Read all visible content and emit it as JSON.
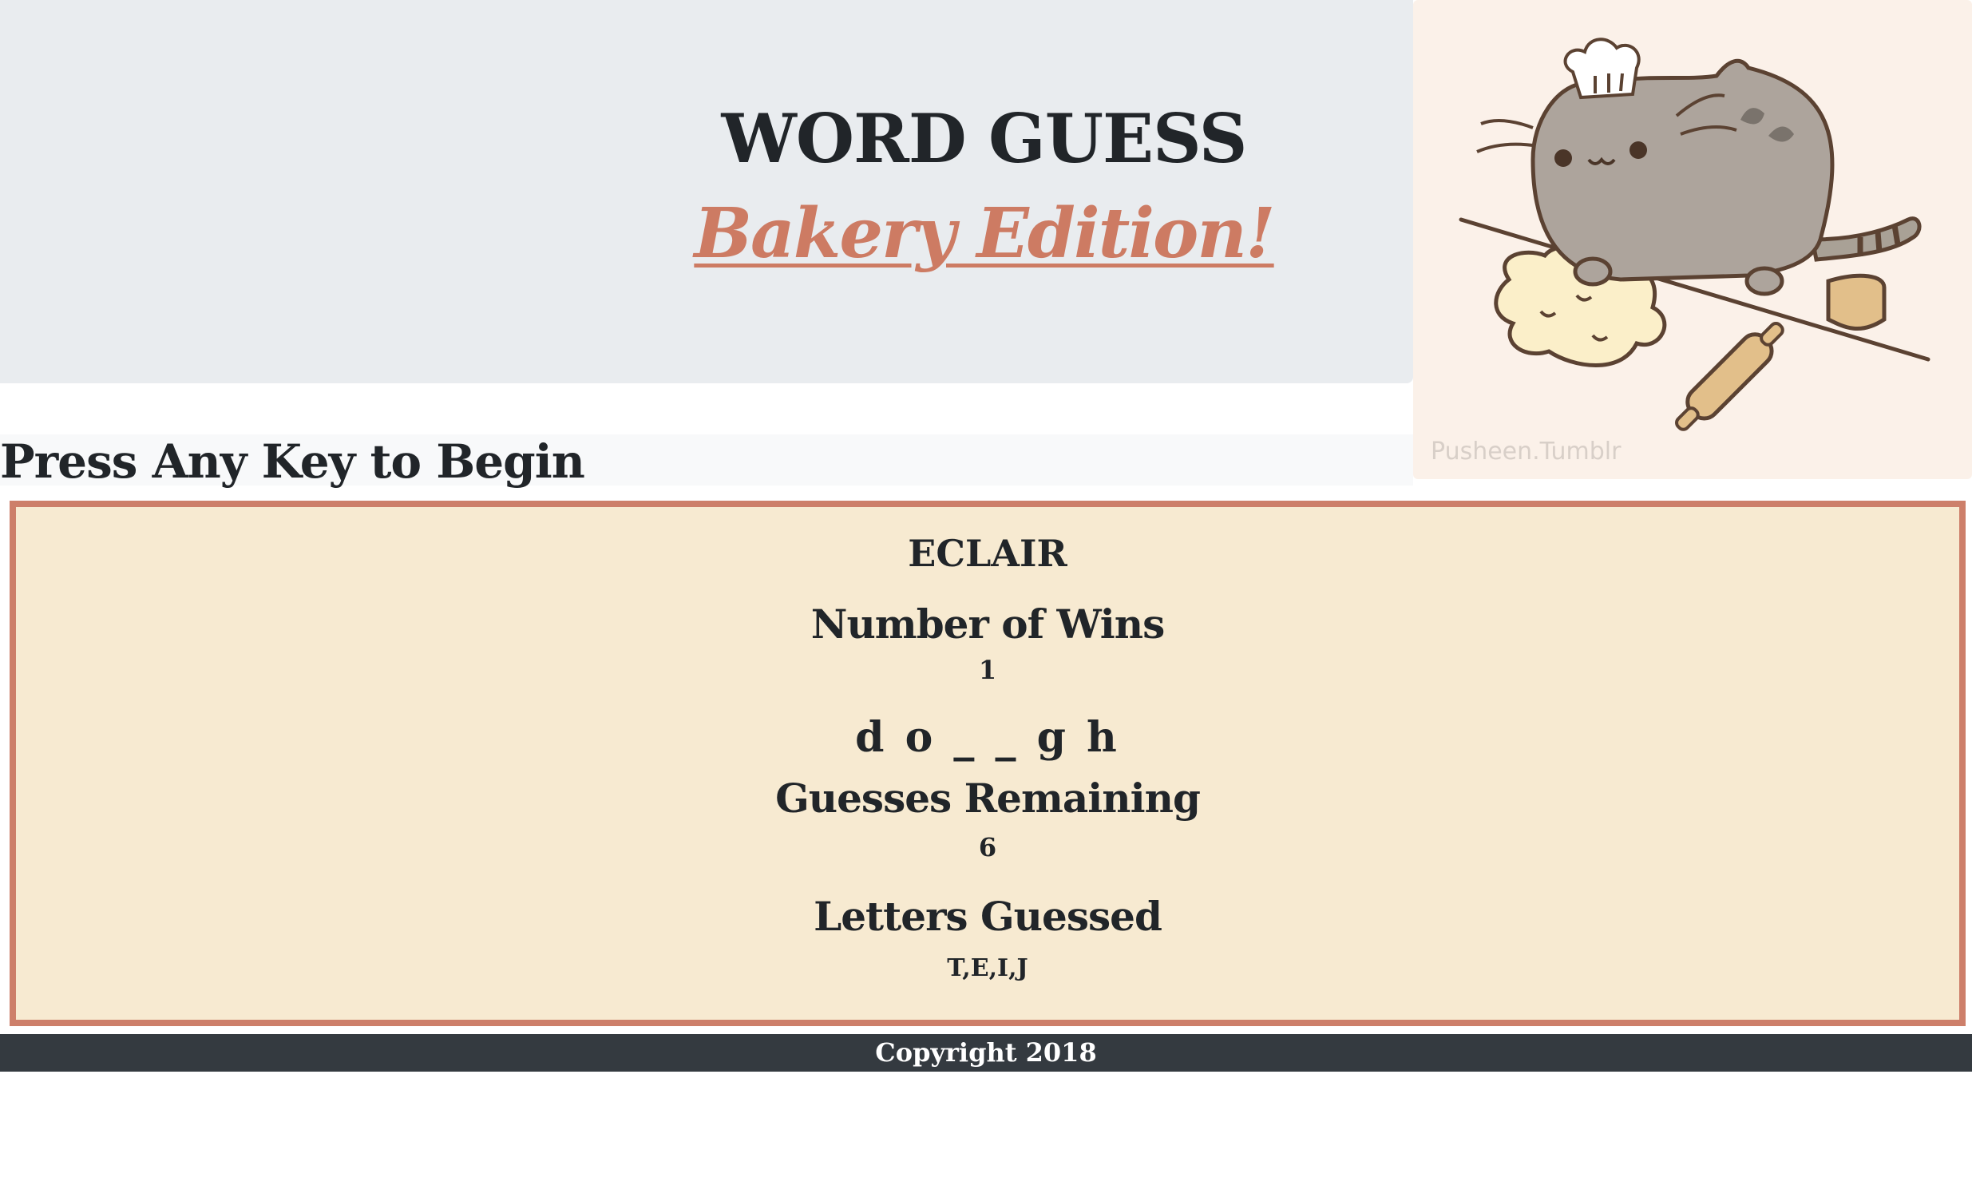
{
  "header": {
    "title": "WORD GUESS",
    "subtitle": "Bakery Edition!"
  },
  "prompt": "Press Any Key to Begin",
  "image": {
    "watermark": "Pusheen.Tumblr"
  },
  "game": {
    "word": "ECLAIR",
    "wins_label": "Number of Wins",
    "wins_value": "1",
    "blanks": "d o _ _ g h",
    "guesses_label": "Guesses Remaining",
    "guesses_value": "6",
    "letters_label": "Letters Guessed",
    "letters_value": "T,E,I,J"
  },
  "footer": {
    "text": "Copyright 2018"
  },
  "colors": {
    "accent": "#cd7b63",
    "box_background": "#f7ead1",
    "jumbotron": "#e9ecef",
    "footer": "#343a40"
  }
}
